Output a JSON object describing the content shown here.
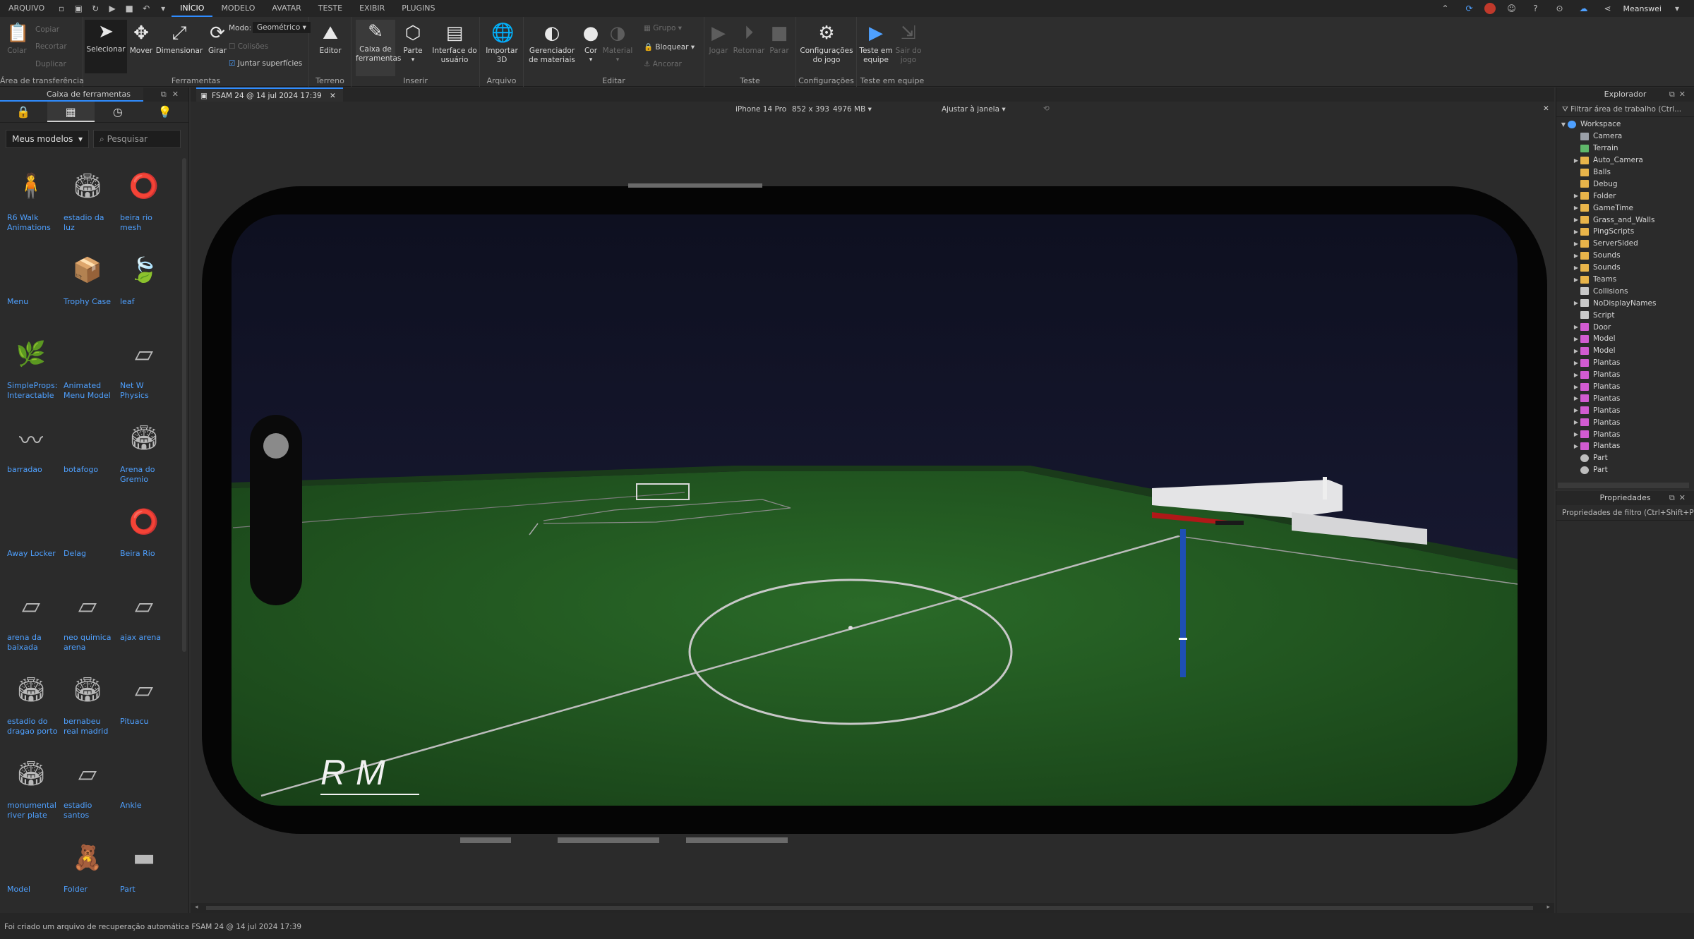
{
  "menu": {
    "file": "ARQUIVO",
    "tabs": [
      "INÍCIO",
      "MODELO",
      "AVATAR",
      "TESTE",
      "EXIBIR",
      "PLUGINS"
    ],
    "user": "Meanswei"
  },
  "ribbon": {
    "clipboard": {
      "paste": "Colar",
      "copy": "Copiar",
      "cut": "Recortar",
      "duplicate": "Duplicar",
      "label": "Área de transferência"
    },
    "tools": {
      "select": "Selecionar",
      "move": "Mover",
      "scale": "Dimensionar",
      "rotate": "Girar",
      "mode_label": "Modo:",
      "mode_value": "Geométrico",
      "collisions": "Colisões",
      "join": "Juntar superfícies",
      "label": "Ferramentas"
    },
    "terrain": {
      "editor": "Editor",
      "label": "Terreno"
    },
    "insert": {
      "toolbox": "Caixa de ferramentas",
      "part": "Parte",
      "ui": "Interface do usuário",
      "label": "Inserir"
    },
    "file": {
      "import3d": "Importar 3D",
      "label": "Arquivo"
    },
    "edit": {
      "material_mgr": "Gerenciador de materiais",
      "color": "Cor",
      "material": "Material",
      "group": "Grupo",
      "lock": "Bloquear",
      "anchor": "Ancorar",
      "label": "Editar"
    },
    "test": {
      "play": "Jogar",
      "resume": "Retomar",
      "stop": "Parar",
      "label": "Teste"
    },
    "settings": {
      "game_settings": "Configurações do jogo",
      "label": "Configurações"
    },
    "team": {
      "team_test": "Teste em equipe",
      "exit_game": "Sair do jogo",
      "label": "Teste em equipe"
    }
  },
  "toolbox": {
    "title": "Caixa de ferramentas",
    "category": "Meus modelos",
    "search_placeholder": "Pesquisar",
    "items": [
      {
        "name": "R6 Walk Animations"
      },
      {
        "name": "estadio da luz"
      },
      {
        "name": "beira rio mesh"
      },
      {
        "name": "Menu"
      },
      {
        "name": "Trophy Case"
      },
      {
        "name": "leaf"
      },
      {
        "name": "SimpleProps: Interactable"
      },
      {
        "name": "Animated Menu Model"
      },
      {
        "name": "Net W Physics"
      },
      {
        "name": "barradao"
      },
      {
        "name": "botafogo"
      },
      {
        "name": "Arena do Gremio"
      },
      {
        "name": "Away Locker"
      },
      {
        "name": "Delag"
      },
      {
        "name": "Beira Rio"
      },
      {
        "name": "arena da baixada"
      },
      {
        "name": "neo quimica arena"
      },
      {
        "name": "ajax arena"
      },
      {
        "name": "estadio do dragao porto"
      },
      {
        "name": "bernabeu real madrid"
      },
      {
        "name": "Pituacu"
      },
      {
        "name": "monumental river plate"
      },
      {
        "name": "estadio santos"
      },
      {
        "name": "Ankle"
      },
      {
        "name": "Model"
      },
      {
        "name": "Folder"
      },
      {
        "name": "Part"
      }
    ]
  },
  "viewport": {
    "tab_title": "FSAM 24 @ 14 jul 2024 17:39",
    "device": "iPhone 14 Pro",
    "resolution": "852 x 393",
    "memory": "4976 MB",
    "fit": "Ajustar à janela",
    "scene_text": "R M"
  },
  "explorer": {
    "title": "Explorador",
    "filter_placeholder": "Filtrar área de trabalho (Ctrl...",
    "items": [
      {
        "name": "Workspace",
        "type": "workspace",
        "level": 0,
        "expanded": true
      },
      {
        "name": "Camera",
        "type": "camera",
        "level": 1
      },
      {
        "name": "Terrain",
        "type": "terrain",
        "level": 1
      },
      {
        "name": "Auto_Camera",
        "type": "folder",
        "level": 1,
        "collapsed": true
      },
      {
        "name": "Balls",
        "type": "folder",
        "level": 1
      },
      {
        "name": "Debug",
        "type": "folder",
        "level": 1
      },
      {
        "name": "Folder",
        "type": "folder",
        "level": 1,
        "collapsed": true
      },
      {
        "name": "GameTime",
        "type": "folder",
        "level": 1,
        "collapsed": true
      },
      {
        "name": "Grass_and_Walls",
        "type": "folder",
        "level": 1,
        "collapsed": true
      },
      {
        "name": "PingScripts",
        "type": "folder",
        "level": 1,
        "collapsed": true
      },
      {
        "name": "ServerSided",
        "type": "folder",
        "level": 1,
        "collapsed": true
      },
      {
        "name": "Sounds",
        "type": "folder",
        "level": 1,
        "collapsed": true
      },
      {
        "name": "Sounds",
        "type": "folder",
        "level": 1,
        "collapsed": true
      },
      {
        "name": "Teams",
        "type": "folder",
        "level": 1,
        "collapsed": true
      },
      {
        "name": "Collisions",
        "type": "script",
        "level": 1
      },
      {
        "name": "NoDisplayNames",
        "type": "script",
        "level": 1,
        "collapsed": true
      },
      {
        "name": "Script",
        "type": "script",
        "level": 1
      },
      {
        "name": "Door",
        "type": "model",
        "level": 1,
        "collapsed": true
      },
      {
        "name": "Model",
        "type": "model",
        "level": 1,
        "collapsed": true
      },
      {
        "name": "Model",
        "type": "model",
        "level": 1,
        "collapsed": true
      },
      {
        "name": "Plantas",
        "type": "model",
        "level": 1,
        "collapsed": true
      },
      {
        "name": "Plantas",
        "type": "model",
        "level": 1,
        "collapsed": true
      },
      {
        "name": "Plantas",
        "type": "model",
        "level": 1,
        "collapsed": true
      },
      {
        "name": "Plantas",
        "type": "model",
        "level": 1,
        "collapsed": true
      },
      {
        "name": "Plantas",
        "type": "model",
        "level": 1,
        "collapsed": true
      },
      {
        "name": "Plantas",
        "type": "model",
        "level": 1,
        "collapsed": true
      },
      {
        "name": "Plantas",
        "type": "model",
        "level": 1,
        "collapsed": true
      },
      {
        "name": "Plantas",
        "type": "model",
        "level": 1,
        "collapsed": true
      },
      {
        "name": "Part",
        "type": "part",
        "level": 1
      },
      {
        "name": "Part",
        "type": "part",
        "level": 1
      }
    ]
  },
  "properties": {
    "title": "Propriedades",
    "filter_placeholder": "Propriedades de filtro (Ctrl+Shift+P)"
  },
  "status": {
    "message": "Foi criado um arquivo de recuperação automática FSAM 24 @ 14 jul 2024 17:39"
  },
  "colors": {
    "accent": "#2f8cff",
    "link": "#4ea0ff",
    "folder": "#e8b44a",
    "pitch": "#235522",
    "sky": "#1c1d3a"
  }
}
